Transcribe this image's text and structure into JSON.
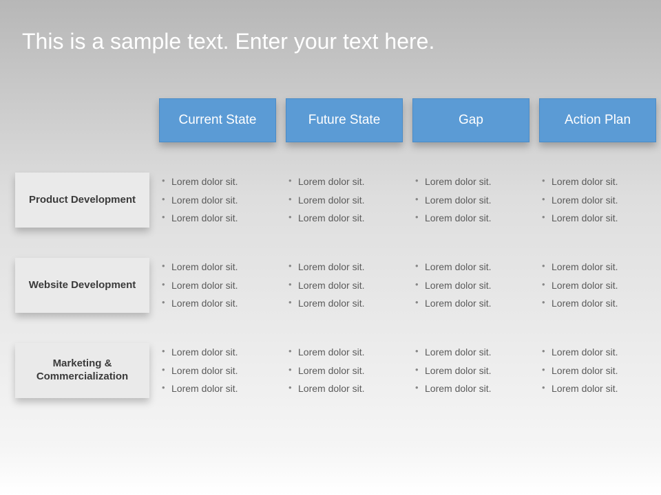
{
  "title": "This is a sample text. Enter your text here.",
  "columns": [
    "Current State",
    "Future State",
    "Gap",
    "Action Plan"
  ],
  "rows": [
    {
      "label": "Product Development",
      "cells": [
        [
          "Lorem dolor sit.",
          "Lorem dolor sit.",
          "Lorem dolor sit."
        ],
        [
          "Lorem dolor sit.",
          "Lorem dolor sit.",
          "Lorem dolor sit."
        ],
        [
          "Lorem dolor sit.",
          "Lorem dolor sit.",
          "Lorem dolor sit."
        ],
        [
          "Lorem dolor sit.",
          "Lorem dolor sit.",
          "Lorem dolor sit."
        ]
      ]
    },
    {
      "label": "Website Development",
      "cells": [
        [
          "Lorem dolor sit.",
          "Lorem dolor sit.",
          "Lorem dolor sit."
        ],
        [
          "Lorem dolor sit.",
          "Lorem dolor sit.",
          "Lorem dolor sit."
        ],
        [
          "Lorem dolor sit.",
          "Lorem dolor sit.",
          "Lorem dolor sit."
        ],
        [
          "Lorem dolor sit.",
          "Lorem dolor sit.",
          "Lorem dolor sit."
        ]
      ]
    },
    {
      "label": "Marketing & Commercialization",
      "cells": [
        [
          "Lorem dolor sit.",
          "Lorem dolor sit.",
          "Lorem dolor sit."
        ],
        [
          "Lorem dolor sit.",
          "Lorem dolor sit.",
          "Lorem dolor sit."
        ],
        [
          "Lorem dolor sit.",
          "Lorem dolor sit.",
          "Lorem dolor sit."
        ],
        [
          "Lorem dolor sit.",
          "Lorem dolor sit.",
          "Lorem dolor sit."
        ]
      ]
    }
  ]
}
